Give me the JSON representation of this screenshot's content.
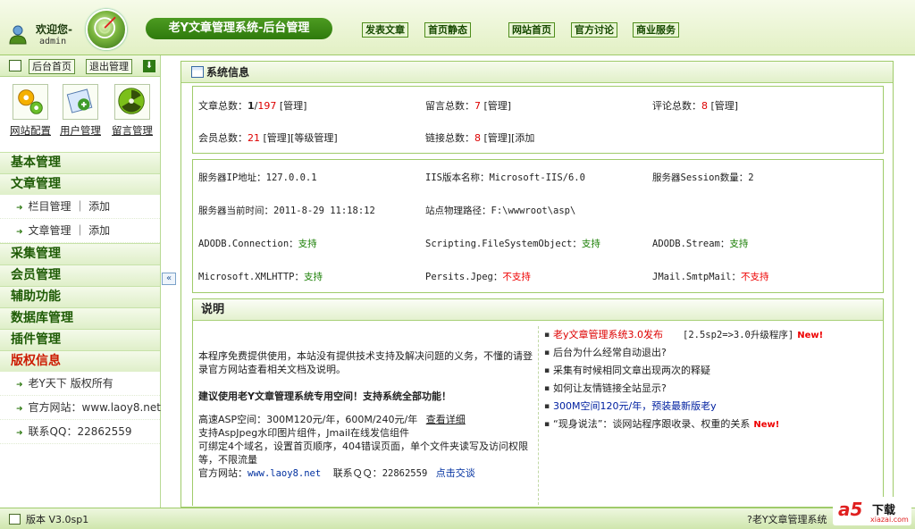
{
  "header": {
    "welcome": "欢迎您-",
    "username": "admin",
    "system_title": "老Y文章管理系统-后台管理",
    "nav": [
      "发表文章",
      "首页静态",
      "网站首页",
      "官方讨论",
      "商业服务"
    ]
  },
  "sidebar": {
    "top_buttons": [
      "后台首页",
      "退出管理"
    ],
    "quick_links": [
      "网站配置",
      "用户管理",
      "留言管理"
    ],
    "menu": [
      {
        "title": "基本管理",
        "items": []
      },
      {
        "title": "文章管理",
        "items": [
          "栏目管理 ｜ 添加",
          "文章管理 ｜ 添加"
        ]
      },
      {
        "title": "采集管理",
        "items": []
      },
      {
        "title": "会员管理",
        "items": []
      },
      {
        "title": "辅助功能",
        "items": []
      },
      {
        "title": "数据库管理",
        "items": []
      },
      {
        "title": "插件管理",
        "items": []
      },
      {
        "title": "版权信息",
        "items": [
          "老Y天下 版权所有",
          "官方网站：www.laoy8.net",
          "联系QQ：22862559"
        ]
      }
    ]
  },
  "main": {
    "title": "系统信息",
    "stats": {
      "article_label": "文章总数：",
      "article_value_a": "1",
      "article_sep": "/",
      "article_value_b": "197",
      "article_links": "[管理]",
      "message_label": "留言总数：",
      "message_value": "7",
      "message_links": "[管理]",
      "comment_label": "评论总数：",
      "comment_value": "8",
      "comment_links": "[管理]",
      "member_label": "会员总数：",
      "member_value": "21",
      "member_links": "[管理][等级管理]",
      "link_label": "链接总数：",
      "link_value": "8",
      "link_links": "[管理][添加"
    },
    "server": {
      "ip_label": "服务器IP地址：",
      "ip_value": "127.0.0.1",
      "iis_label": "IIS版本名称：",
      "iis_value": "Microsoft-IIS/6.0",
      "session_label": "服务器Session数量：",
      "session_value": "2",
      "time_label": "服务器当前时间：",
      "time_value": "2011-8-29 11:18:12",
      "path_label": "站点物理路径：",
      "path_value": "F:\\wwwroot\\asp\\",
      "components": [
        {
          "name": "ADODB.Connection：",
          "status": "支持",
          "ok": true
        },
        {
          "name": "Scripting.FileSystemObject：",
          "status": "支持",
          "ok": true
        },
        {
          "name": "ADODB.Stream：",
          "status": "支持",
          "ok": true
        },
        {
          "name": "Microsoft.XMLHTTP：",
          "status": "支持",
          "ok": true
        },
        {
          "name": "Persits.Jpeg：",
          "status": "不支持",
          "ok": false
        },
        {
          "name": "JMail.SmtpMail：",
          "status": "不支持",
          "ok": false
        }
      ]
    },
    "description": {
      "heading": "说明",
      "intro": "本程序免费提供使用，本站没有提供技术支持及解决问题的义务，不懂的请登录官方网站查看相关文档及说明。",
      "recommend": "建议使用老Y文章管理系统专用空间！支持系统全部功能！",
      "hosting": "高速ASP空间：300M120元/年，600M/240元/年",
      "hosting_link": "查看详细",
      "feature1": "支持AspJpeg水印图片组件，Jmail在线发信组件",
      "feature2": "可绑定4个域名，设置首页顺序，404错误页面，单个文件夹读写及访问权限等，不限流量",
      "site_label": "官方网站：",
      "site_url": "www.laoy8.net",
      "qq_label": "联系ＱＱ：",
      "qq_value": "22862559",
      "chat_link": "点击交谈",
      "news": [
        {
          "text": "老y文章管理系统3.0发布",
          "extra": "[2.5sp2=>3.0升级程序]",
          "new": "New!",
          "style": "red"
        },
        {
          "text": "后台为什么经常自动退出?",
          "extra": "",
          "new": "",
          "style": ""
        },
        {
          "text": "采集有时候相同文章出现两次的释疑",
          "extra": "",
          "new": "",
          "style": ""
        },
        {
          "text": "如何让友情链接全站显示?",
          "extra": "",
          "new": "",
          "style": ""
        },
        {
          "text": "300M空间120元/年，预装最新版老y",
          "extra": "",
          "new": "",
          "style": "blue"
        },
        {
          "text": "“现身说法”：谈网站程序跟收录、权重的关系",
          "extra": "",
          "new": "New!",
          "style": ""
        }
      ]
    }
  },
  "footer": {
    "version": "版本 V3.0sp1",
    "help": "?老Y文章管理系统",
    "watermark_a5": "a5",
    "watermark_xz": "下载",
    "watermark_url": "xiazai.com"
  },
  "colors": {
    "accent_green": "#2e7a0c",
    "menu_green": "#1f5c06",
    "red_value": "#dd0000",
    "support_green": "#177d00"
  }
}
